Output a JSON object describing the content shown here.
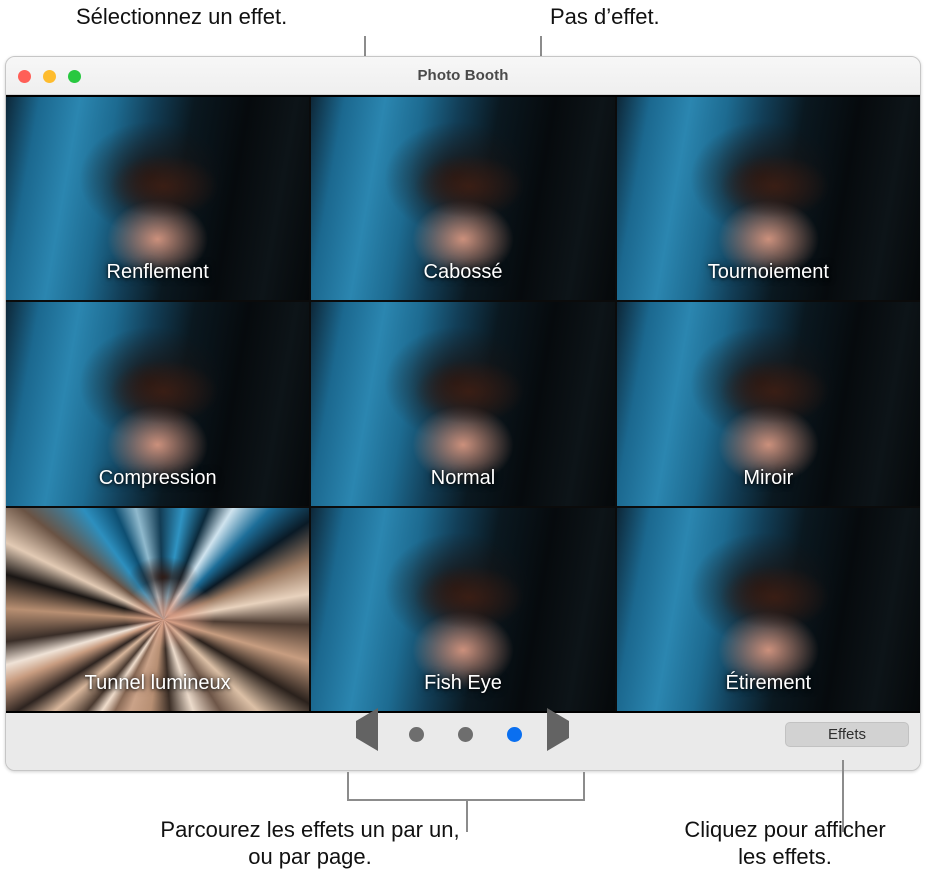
{
  "annotations": {
    "top_left": "Sélectionnez un effet.",
    "top_right": "Pas d’effet.",
    "bottom_left": "Parcourez les effets un par un, ou par page.",
    "bottom_right": "Cliquez pour afficher les effets."
  },
  "window": {
    "title": "Photo Booth",
    "traffic_lights": [
      {
        "name": "close",
        "color": "#ff5f57"
      },
      {
        "name": "minimize",
        "color": "#febc2e"
      },
      {
        "name": "zoom",
        "color": "#28c840"
      }
    ]
  },
  "effects_grid": {
    "columns": 3,
    "rows": 3,
    "cells": [
      {
        "label": "Renflement",
        "style": "normal",
        "selected": false
      },
      {
        "label": "Cabossé",
        "style": "normal",
        "selected": false
      },
      {
        "label": "Tournoiement",
        "style": "normal",
        "selected": false
      },
      {
        "label": "Compression",
        "style": "normal",
        "selected": false
      },
      {
        "label": "Normal",
        "style": "normal",
        "selected": true
      },
      {
        "label": "Miroir",
        "style": "normal",
        "selected": false
      },
      {
        "label": "Tunnel lumineux",
        "style": "tunnel",
        "selected": false
      },
      {
        "label": "Fish Eye",
        "style": "normal",
        "selected": false
      },
      {
        "label": "Étirement",
        "style": "normal",
        "selected": false
      }
    ]
  },
  "toolbar": {
    "previous_icon": "triangle-left-icon",
    "next_icon": "triangle-right-icon",
    "page_dots": [
      {
        "index": 1,
        "active": false
      },
      {
        "index": 2,
        "active": false
      },
      {
        "index": 3,
        "active": true
      }
    ],
    "active_page": 3,
    "total_pages": 3,
    "effects_button_label": "Effets",
    "accent_color": "#0a6ff0",
    "dot_color": "#6e6e6e"
  }
}
